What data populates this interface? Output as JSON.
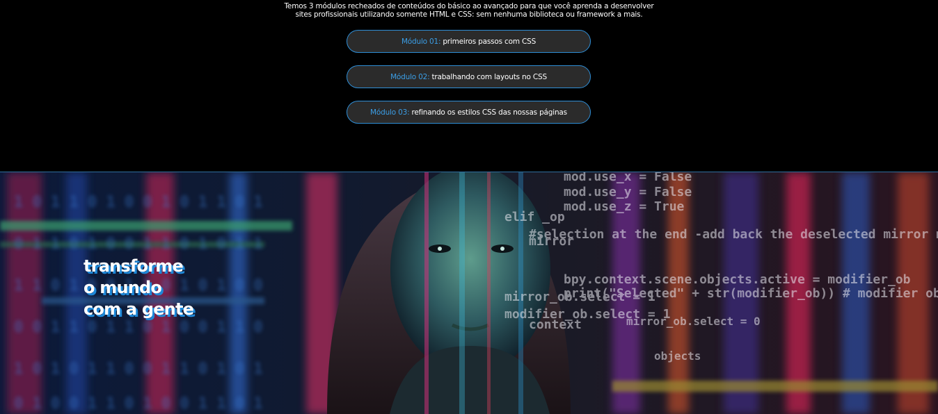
{
  "intro": {
    "line1": "Temos 3 módulos recheados de conteúdos do básico ao avançado para que você aprenda a desenvolver",
    "line2": "sites profissionais utilizando somente HTML e CSS: sem nenhuma biblioteca ou framework a mais."
  },
  "modules": [
    {
      "label": "Módulo 01:",
      "text": "primeiros passos com CSS"
    },
    {
      "label": "Módulo 02:",
      "text": "trabalhando com layouts no CSS"
    },
    {
      "label": "Módulo 03:",
      "text": "refinando os estilos CSS das nossas páginas"
    }
  ],
  "hero": {
    "headline": [
      "transforme",
      "o mundo",
      "com a gente"
    ],
    "code_lines": [
      "mod.use_x = False",
      "mod.use_y = False",
      "mod.use_z = True",
      "elif _op",
      "mirror",
      "#selection at the end -add back the deselected mirror modifier ob",
      "mirror_ob.select = 1",
      "modifier_ob.select = 1",
      "bpy.context.scene.objects.active = modifier_ob",
      "print(\"Selected\" + str(modifier_ob)) # modifier ob is the active ob",
      "mirror_ob.select = 0",
      "context",
      "objects"
    ],
    "binary_rows": [
      "1 0 1 1 0 1 0 0 1 0 1 1 0 1",
      "0 1 1 0 1 0 0 1 1 0 1 0 1 1",
      "1 1 0 1 0 0 1 1 0 1 0 1 0 0",
      "0 0 1 1 0 1 1 0 1 0 0 1 1 0",
      "1 0 1 0 1 1 0 0 1 1 0 1 0 1",
      "0 1 0 0 1 1 0 1 0 0 1 1 0 1"
    ]
  },
  "colors": {
    "accent": "#3b9ee6",
    "border": "#2f8fd8",
    "button_bg": "#2b2b2b",
    "headline_shadow": "#1e88d8"
  }
}
